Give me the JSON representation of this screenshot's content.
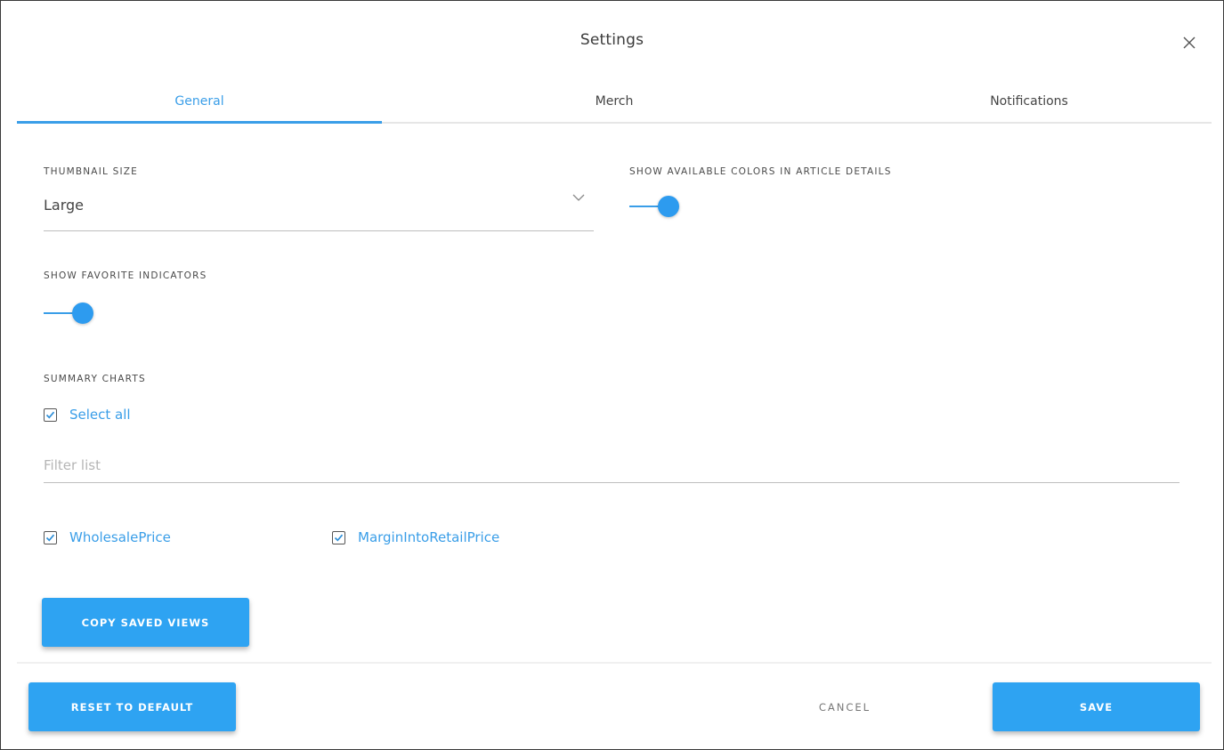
{
  "dialog": {
    "title": "Settings",
    "close_icon": "close-icon"
  },
  "tabs": [
    {
      "label": "General",
      "active": true
    },
    {
      "label": "Merch",
      "active": false
    },
    {
      "label": "Notifications",
      "active": false
    }
  ],
  "general": {
    "thumbnail_size": {
      "label": "THUMBNAIL SIZE",
      "value": "Large"
    },
    "show_available_colors": {
      "label": "SHOW AVAILABLE COLORS IN ARTICLE DETAILS",
      "enabled": true
    },
    "show_favorite_indicators": {
      "label": "SHOW FAVORITE INDICATORS",
      "enabled": true
    },
    "summary_charts": {
      "label": "SUMMARY CHARTS",
      "select_all_label": "Select all",
      "select_all_checked": true,
      "filter_placeholder": "Filter list",
      "items": [
        {
          "label": "WholesalePrice",
          "checked": true
        },
        {
          "label": "MarginIntoRetailPrice",
          "checked": true
        }
      ]
    },
    "copy_saved_views_label": "COPY SAVED VIEWS"
  },
  "footer": {
    "reset_label": "RESET TO DEFAULT",
    "cancel_label": "CANCEL",
    "save_label": "SAVE"
  },
  "colors": {
    "accent": "#2ea3f2",
    "link": "#3a9ee8"
  }
}
